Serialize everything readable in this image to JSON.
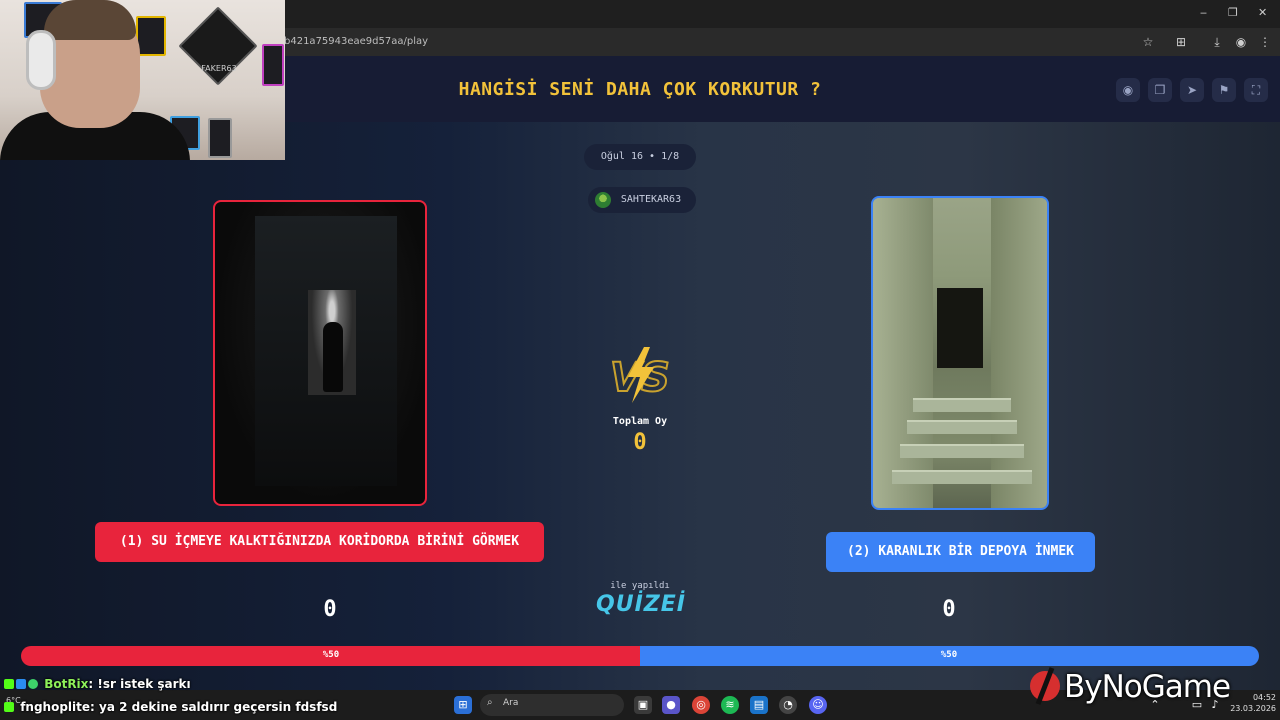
{
  "browser": {
    "url": "b421a75943eae9d57aa/play",
    "window_controls": {
      "minimize": "‒",
      "maximize": "❐",
      "close": "✕"
    }
  },
  "quiz": {
    "title": "HANGİSİ SENİ DAHA ÇOK KORKUTUR ?",
    "round_info": "Oğul 16 • 1/8",
    "username": "SAHTEKAR63",
    "vs_label": "VS",
    "total_votes_label": "Toplam Oy",
    "total_votes_value": "0",
    "made_with": "ile yapıldı",
    "brand": "QUİZEİ",
    "options": [
      {
        "label": "(1) SU İÇMEYE KALKTIĞINIZDA KORİDORDA BİRİNİ GÖRMEK",
        "votes": "0",
        "percent_text": "%50",
        "percent": 50,
        "color": "#e8243c"
      },
      {
        "label": "(2) KARANLIK BİR DEPOYA İNMEK",
        "votes": "0",
        "percent_text": "%50",
        "percent": 50,
        "color": "#3b82f6"
      }
    ]
  },
  "chat": [
    {
      "user": "BotRix",
      "message": ": !sr istek şarkı"
    },
    {
      "user": "fnghoplite",
      "message": ": ya 2 dekine saldırır geçersin fdsfsd"
    }
  ],
  "taskbar": {
    "search_placeholder": "Ara",
    "weather": "6°C",
    "time": "04:52",
    "date": "23.03.2026"
  },
  "overlay": {
    "stream_brand": "ByNoGame",
    "poster_text": "FAKER63"
  },
  "colors": {
    "accent_yellow": "#f2c23a",
    "option_red": "#e8243c",
    "option_blue": "#3b82f6"
  }
}
